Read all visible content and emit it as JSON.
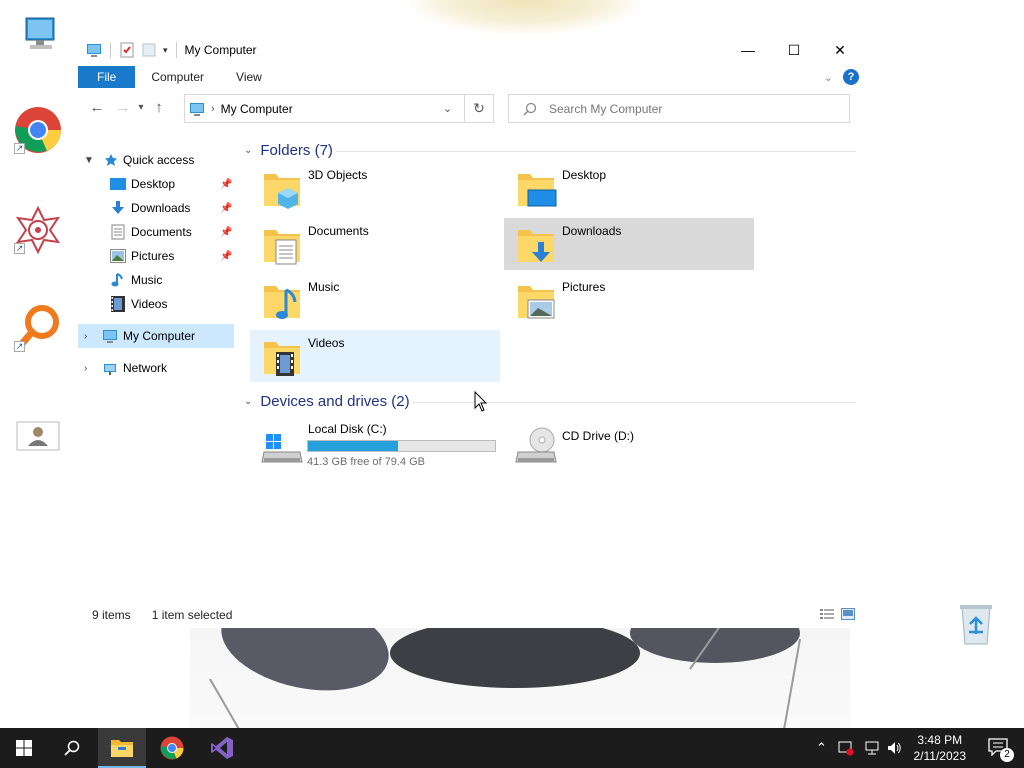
{
  "window": {
    "title": "My Computer",
    "controls": {
      "minimize": "—",
      "maximize": "☐",
      "close": "✕"
    }
  },
  "ribbon": {
    "tabs": [
      "File",
      "Computer",
      "View"
    ],
    "help": "?"
  },
  "navigation": {
    "back": "←",
    "forward": "→",
    "recent": "▾",
    "up": "↑",
    "address": "My Computer",
    "search_placeholder": "Search My Computer"
  },
  "sidebar": {
    "quick_access": "Quick access",
    "pinned": [
      {
        "label": "Desktop",
        "icon": "desktop-icon",
        "pinned": true
      },
      {
        "label": "Downloads",
        "icon": "downloads-icon",
        "pinned": true
      },
      {
        "label": "Documents",
        "icon": "documents-icon",
        "pinned": true
      },
      {
        "label": "Pictures",
        "icon": "pictures-icon",
        "pinned": true
      },
      {
        "label": "Music",
        "icon": "music-icon",
        "pinned": false
      },
      {
        "label": "Videos",
        "icon": "videos-icon",
        "pinned": false
      }
    ],
    "my_computer": "My Computer",
    "network": "Network"
  },
  "folders": {
    "header": "Folders (7)",
    "items": [
      {
        "label": "3D Objects",
        "icon": "3d-objects-icon"
      },
      {
        "label": "Desktop",
        "icon": "desktop-folder-icon"
      },
      {
        "label": "Documents",
        "icon": "documents-folder-icon"
      },
      {
        "label": "Downloads",
        "icon": "downloads-folder-icon",
        "selected": true
      },
      {
        "label": "Music",
        "icon": "music-folder-icon"
      },
      {
        "label": "Pictures",
        "icon": "pictures-folder-icon"
      },
      {
        "label": "Videos",
        "icon": "videos-folder-icon",
        "hover": true
      }
    ]
  },
  "devices": {
    "header": "Devices and drives (2)",
    "local_disk": {
      "label": "Local Disk (C:)",
      "free_text": "41.3 GB free of 79.4 GB",
      "used_fraction": 0.48
    },
    "cd_drive": {
      "label": "CD Drive (D:)"
    }
  },
  "status": {
    "count": "9 items",
    "selection": "1 item selected"
  },
  "taskbar": {
    "time": "3:48 PM",
    "date": "2/11/2023",
    "notifications": "2"
  },
  "colors": {
    "accent": "#1979ca",
    "group_header": "#1e3287",
    "selected_nav": "#cce8ff",
    "tile_hover": "#e5f3ff",
    "tile_selected": "#d9d9d9",
    "drive_fill": "#26a0da",
    "taskbar": "#1c1c1c"
  }
}
